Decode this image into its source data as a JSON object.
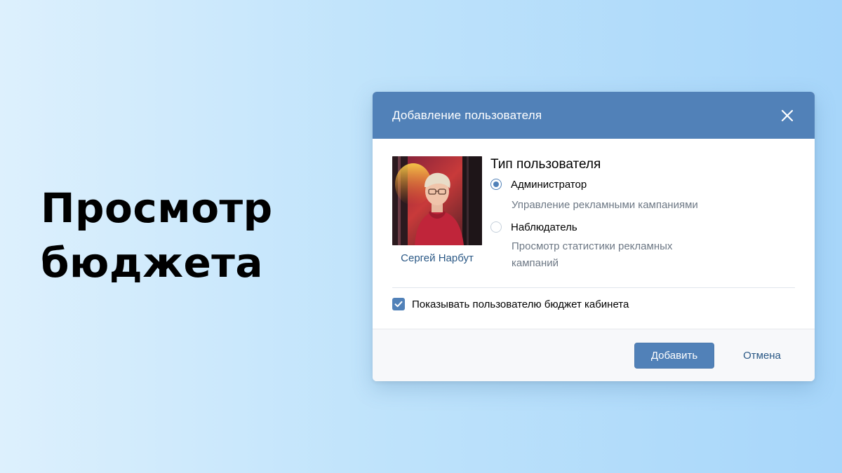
{
  "headline": {
    "line1": "Просмотр",
    "line2": "бюджета"
  },
  "dialog": {
    "title": "Добавление пользователя",
    "close_icon": "close-icon",
    "user": {
      "name": "Сергей Нарбут",
      "avatar_icon": "user-avatar-photo"
    },
    "role_section": {
      "title": "Тип пользователя",
      "options": [
        {
          "label": "Администратор",
          "description": "Управление рекламными кампаниями",
          "selected": true
        },
        {
          "label": "Наблюдатель",
          "description": "Просмотр статистики рекламных кампаний",
          "selected": false
        }
      ]
    },
    "show_budget": {
      "label": "Показывать пользователю бюджет кабинета",
      "checked": true
    },
    "buttons": {
      "add": "Добавить",
      "cancel": "Отмена"
    }
  },
  "colors": {
    "accent": "#5181b8",
    "link": "#2a5885",
    "muted_text": "#6d7885"
  }
}
